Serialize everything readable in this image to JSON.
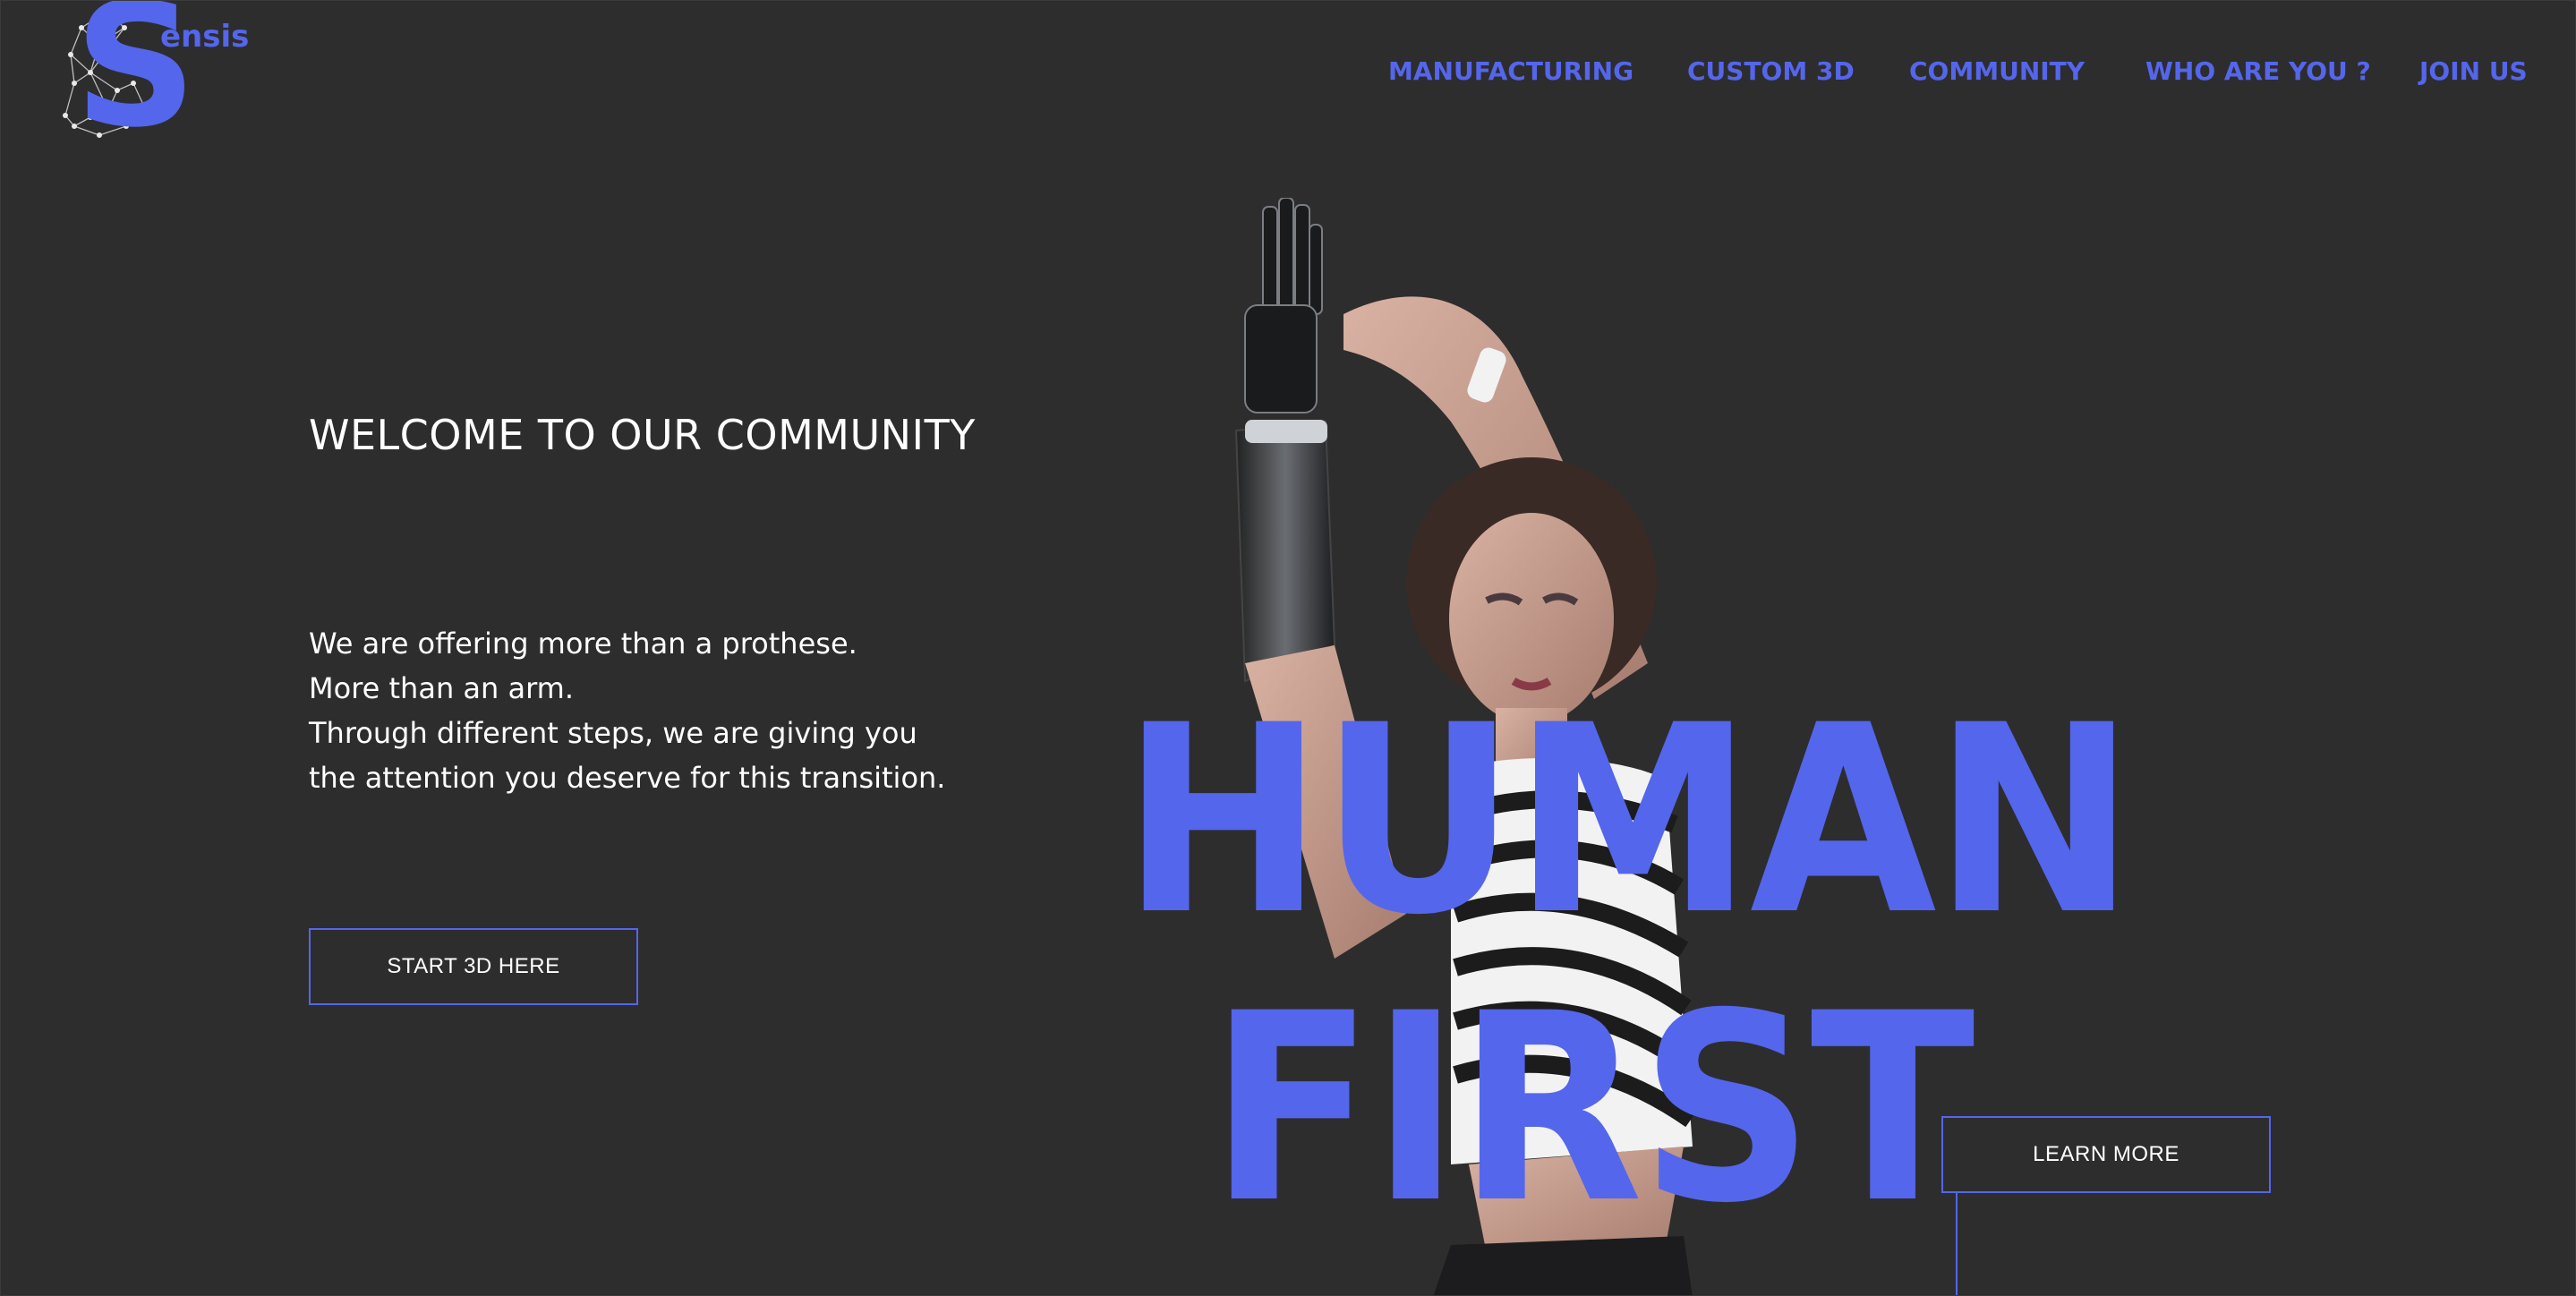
{
  "brand": {
    "logo_letter": "S",
    "logo_word": "ensis",
    "accent_color": "#5466ec",
    "background_color": "#2d2d2e"
  },
  "nav": {
    "items": [
      {
        "label": "MANUFACTURING"
      },
      {
        "label": "CUSTOM 3D"
      },
      {
        "label": "COMMUNITY"
      },
      {
        "label": "WHO ARE YOU ?"
      },
      {
        "label": "JOIN US"
      }
    ]
  },
  "hero": {
    "welcome": "WELCOME TO OUR COMMUNITY",
    "body_lines": [
      "We are offering more than a prothese.",
      "More than an arm.",
      "Through different steps, we are giving you",
      "the attention you deserve for this transition."
    ],
    "cta_primary": "START 3D HERE",
    "cta_secondary": "LEARN MORE",
    "headline_line1": "HUMAN",
    "headline_line2": "FIRST",
    "image": "woman-with-prosthetic-arm-photo"
  }
}
